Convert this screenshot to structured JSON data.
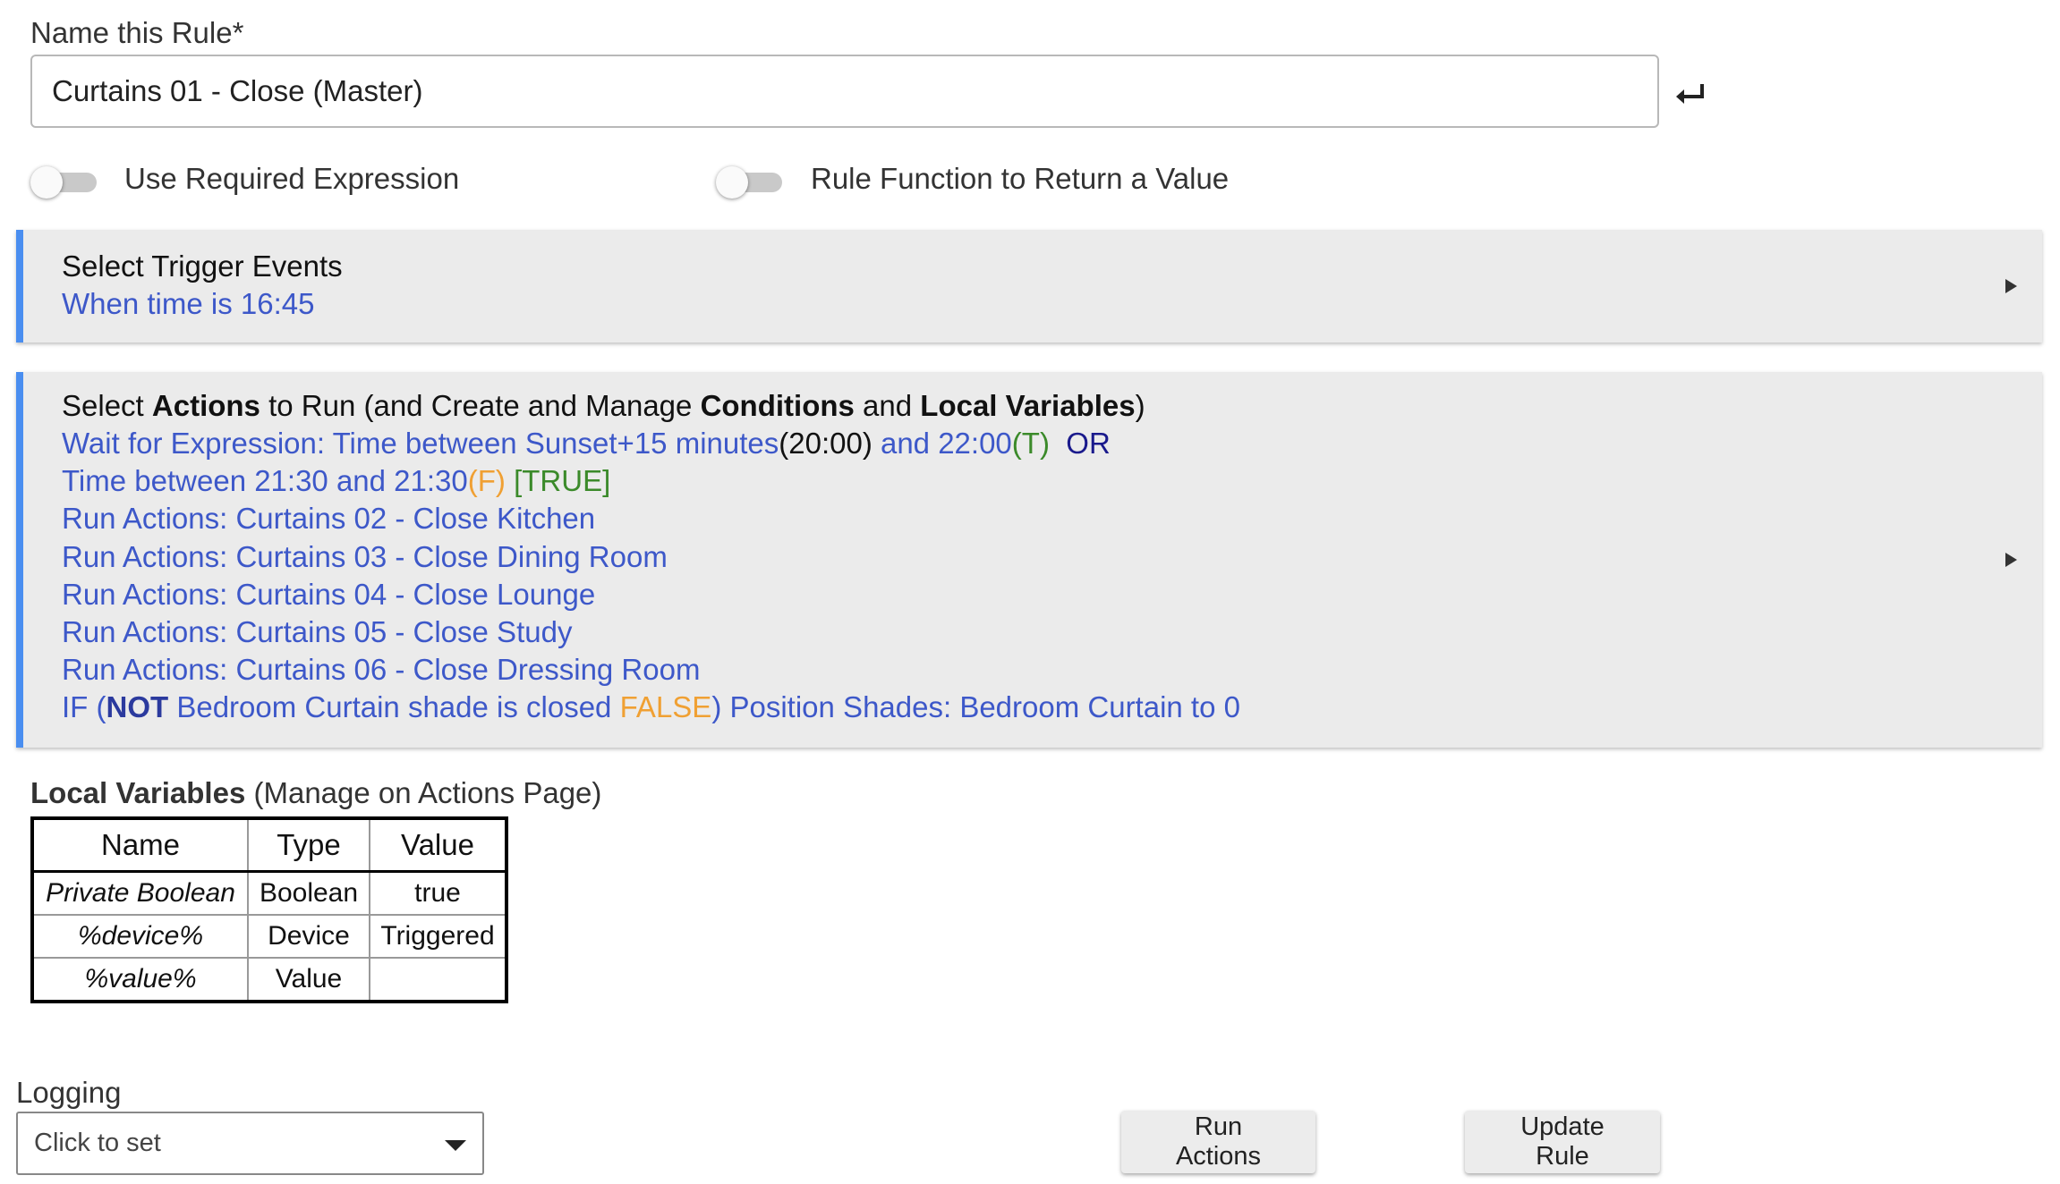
{
  "name_rule": {
    "label": "Name this Rule*",
    "value": "Curtains 01 - Close (Master)",
    "submit_icon": "enter-return-icon"
  },
  "toggles": [
    {
      "label": "Use Required Expression",
      "on": false
    },
    {
      "label": "Rule Function to Return a Value",
      "on": false
    }
  ],
  "trigger_panel": {
    "title": "Select Trigger Events",
    "line": "When time is 16:45",
    "expand_icon": "expand-arrow-icon"
  },
  "actions_panel": {
    "title": {
      "p1": "Select ",
      "b1": "Actions",
      "p2": " to Run (and Create and Manage ",
      "b2": "Conditions",
      "p3": " and ",
      "b3": "Local Variables",
      "p4": ")"
    },
    "wait": {
      "a": "Wait for Expression: Time between Sunset+15 minutes",
      "b": "(20:00)",
      "c": " and 22:00",
      "d": "(T)",
      "e": "OR"
    },
    "time": {
      "a": "Time between 21:30 and 21:30",
      "b": "(F)",
      "c": "[TRUE]"
    },
    "run_actions": [
      "Run Actions: Curtains 02 - Close Kitchen",
      "Run Actions: Curtains 03 - Close Dining Room",
      "Run Actions: Curtains 04 - Close Lounge",
      "Run Actions: Curtains 05 - Close Study",
      "Run Actions: Curtains 06 - Close Dressing Room"
    ],
    "if_line": {
      "a": "IF (",
      "b": "NOT",
      "c": " Bedroom Curtain shade is closed ",
      "d": "FALSE",
      "e": ") Position Shades: Bedroom Curtain to 0"
    },
    "expand_icon": "expand-arrow-icon"
  },
  "local_variables": {
    "title_bold": "Local Variables",
    "title_rest": " (Manage on Actions Page)",
    "headers": [
      "Name",
      "Type",
      "Value"
    ],
    "rows": [
      [
        "Private Boolean",
        "Boolean",
        "true"
      ],
      [
        "%device%",
        "Device",
        "Triggered"
      ],
      [
        "%value%",
        "Value",
        ""
      ]
    ]
  },
  "logging": {
    "label": "Logging",
    "value": "Click to set",
    "caret_icon": "dropdown-caret-icon"
  },
  "buttons": {
    "run_actions": "Run Actions",
    "update_rule": "Update Rule"
  },
  "colors": {
    "accent_border": "#4a8ef0",
    "link_blue": "#3d58c9",
    "true_green": "#3b8a2a",
    "false_orange": "#f0a033",
    "or_navy": "#1a1a8c"
  }
}
